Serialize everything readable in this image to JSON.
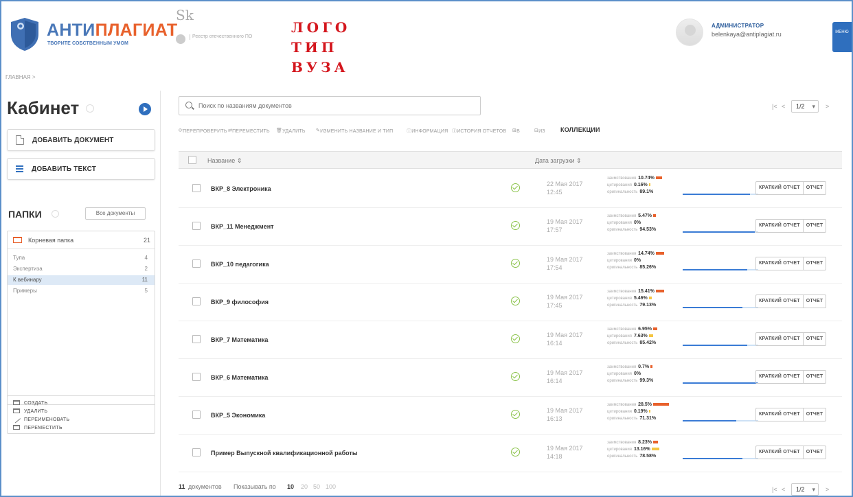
{
  "header": {
    "brand_part1": "АНТИ",
    "brand_part2": "ПЛАГИАТ",
    "tagline": "ТВОРИТЕ СОБСТВЕННЫМ УМОМ",
    "sk_label": "Sk",
    "registry_label": "Реестр отечественного ПО",
    "vuz_logo": [
      "ЛОГО",
      "ТИП",
      "ВУЗА"
    ],
    "user_role": "АДМИНИСТРАТОР",
    "user_email": "belenkaya@antiplagiat.ru",
    "menu_label": "МЕНЮ"
  },
  "breadcrumb": "ГЛАВНАЯ >",
  "sidebar": {
    "title": "Кабинет",
    "add_document": "ДОБАВИТЬ ДОКУМЕНТ",
    "add_text": "ДОБАВИТЬ ТЕКСТ",
    "folders_title": "ПАПКИ",
    "all_documents": "Все документы",
    "root_folder": {
      "name": "Корневая папка",
      "count": "21"
    },
    "subfolders": [
      {
        "name": "Тупа",
        "count": "4"
      },
      {
        "name": "Экспертиза",
        "count": "2"
      },
      {
        "name": "К вебинару",
        "count": "11"
      },
      {
        "name": "Примеры",
        "count": "5"
      }
    ],
    "folder_actions": [
      "СОЗДАТЬ",
      "УДАЛИТЬ",
      "ПЕРЕИМЕНОВАТЬ",
      "ПЕРЕМЕСТИТЬ"
    ]
  },
  "main": {
    "search_placeholder": "Поиск по названиям документов",
    "toolbar": {
      "recheck": "ПЕРЕПРОВЕРИТЬ",
      "move": "ПЕРЕМЕСТИТЬ",
      "delete": "УДАЛИТЬ",
      "rename": "ИЗМЕНИТЬ НАЗВАНИЕ И ТИП",
      "info": "ИНФОРМАЦИЯ",
      "history": "ИСТОРИЯ ОТЧЕТОВ",
      "in": "В",
      "from": "ИЗ",
      "collections": "КОЛЛЕКЦИИ"
    },
    "pager": {
      "first": "|<",
      "prev": "<",
      "page": "1/2",
      "next": ">"
    },
    "columns": {
      "name": "Название",
      "date": "Дата загрузки"
    },
    "stat_labels": {
      "borrow": "заимствования",
      "cite": "цитирования",
      "orig": "оригинальность"
    },
    "report_short": "КРАТКИЙ ОТЧЕТ",
    "report_full": "ОТЧЕТ",
    "rows": [
      {
        "name": "ВКР_8 Электроника",
        "date": "22 Мая 2017",
        "time": "12:45",
        "borrow": "10.74%",
        "cite": "0.16%",
        "orig": "89.1%",
        "borrow_pct": 10.74,
        "cite_pct": 0.16,
        "orig_pct": 89.1
      },
      {
        "name": "ВКР_11 Менеджмент",
        "date": "19 Мая 2017",
        "time": "17:57",
        "borrow": "5.47%",
        "cite": "0%",
        "orig": "94.53%",
        "borrow_pct": 5.47,
        "cite_pct": 0,
        "orig_pct": 94.53
      },
      {
        "name": "ВКР_10 педагогика",
        "date": "19 Мая 2017",
        "time": "17:54",
        "borrow": "14.74%",
        "cite": "0%",
        "orig": "85.26%",
        "borrow_pct": 14.74,
        "cite_pct": 0,
        "orig_pct": 85.26
      },
      {
        "name": "ВКР_9 философия",
        "date": "19 Мая 2017",
        "time": "17:45",
        "borrow": "15.41%",
        "cite": "5.46%",
        "orig": "79.13%",
        "borrow_pct": 15.41,
        "cite_pct": 5.46,
        "orig_pct": 79.13
      },
      {
        "name": "ВКР_7 Математика",
        "date": "19 Мая 2017",
        "time": "16:14",
        "borrow": "6.95%",
        "cite": "7.63%",
        "orig": "85.42%",
        "borrow_pct": 6.95,
        "cite_pct": 7.63,
        "orig_pct": 85.42
      },
      {
        "name": "ВКР_6 Математика",
        "date": "19 Мая 2017",
        "time": "16:14",
        "borrow": "0.7%",
        "cite": "0%",
        "orig": "99.3%",
        "borrow_pct": 0.7,
        "cite_pct": 0,
        "orig_pct": 99.3
      },
      {
        "name": "ВКР_5 Экономика",
        "date": "19 Мая 2017",
        "time": "16:13",
        "borrow": "28.5%",
        "cite": "0.19%",
        "orig": "71.31%",
        "borrow_pct": 28.5,
        "cite_pct": 0.19,
        "orig_pct": 71.31
      },
      {
        "name": "Пример Выпускной квалификационной работы",
        "date": "19 Мая 2017",
        "time": "14:18",
        "borrow": "8.23%",
        "cite": "13.16%",
        "orig": "78.58%",
        "borrow_pct": 8.23,
        "cite_pct": 13.16,
        "orig_pct": 78.58
      }
    ],
    "footer": {
      "count": "11",
      "count_label": "документов",
      "show_by": "Показывать по",
      "sizes": [
        "10",
        "20",
        "50",
        "100"
      ]
    }
  },
  "colors": {
    "brand_blue": "#4a78b8",
    "brand_orange": "#e8612c",
    "accent": "#2f6fbe",
    "vuz_red": "#d4161d"
  }
}
